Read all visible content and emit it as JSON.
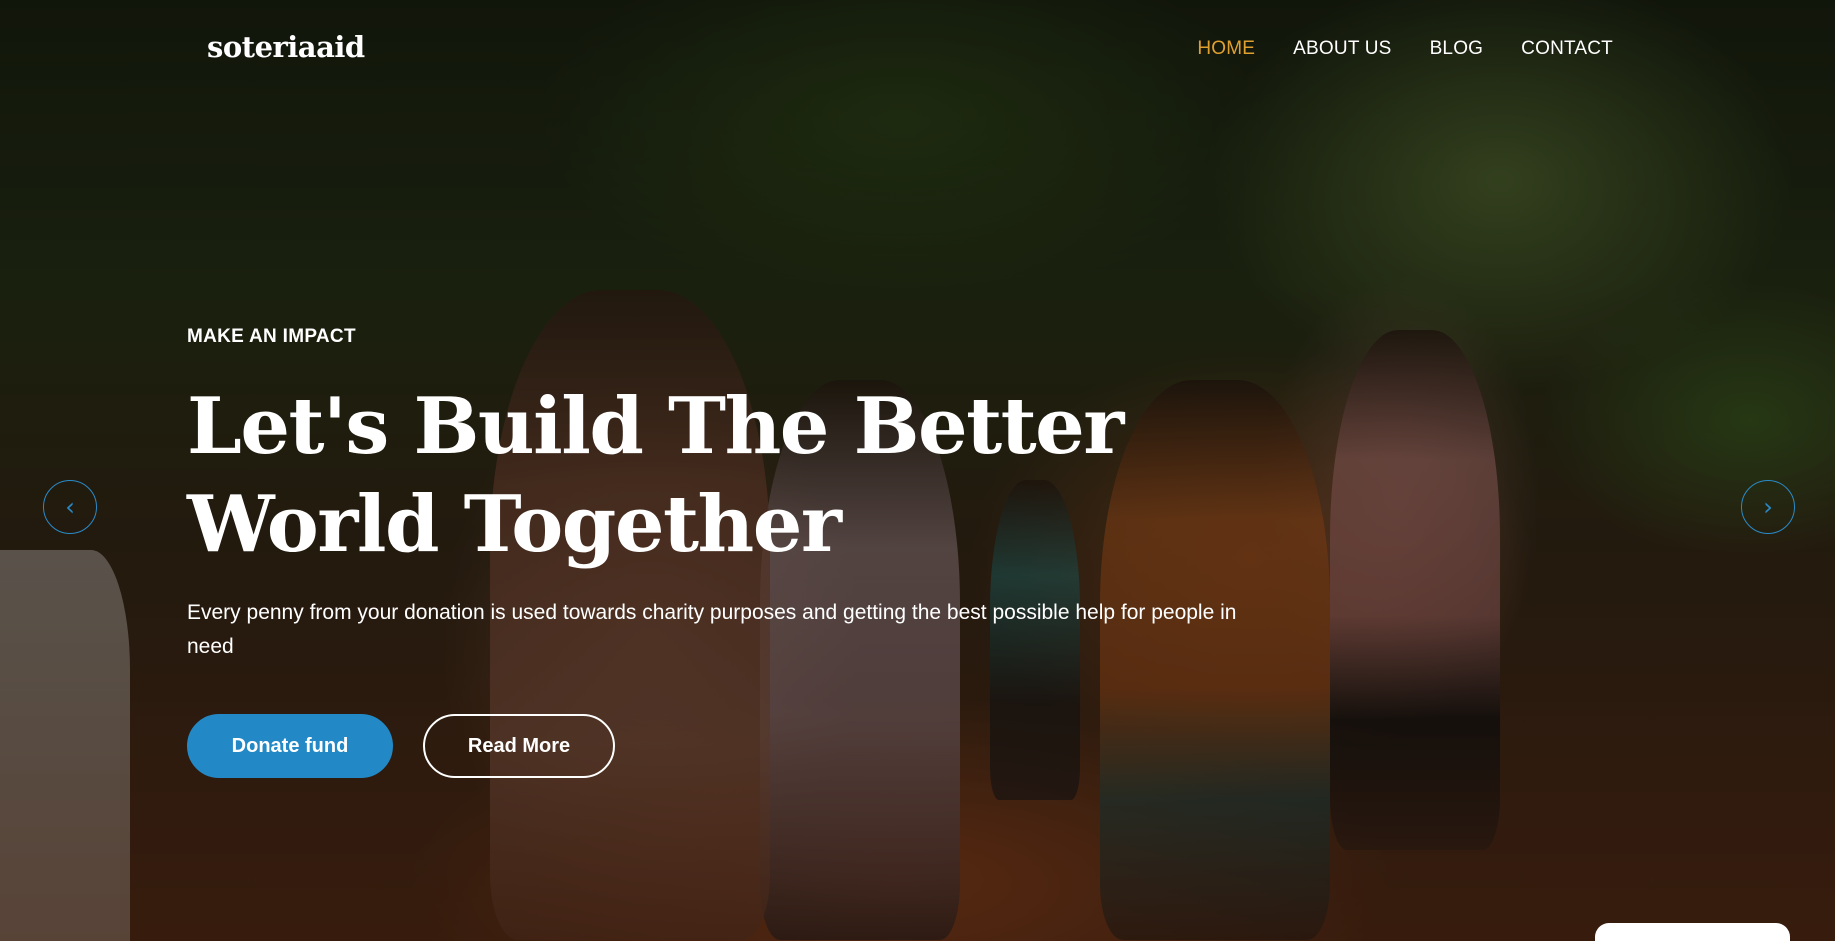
{
  "brand": {
    "logo": "soteriaaid"
  },
  "nav": {
    "items": [
      {
        "label": "HOME",
        "active": true
      },
      {
        "label": "ABOUT US",
        "active": false
      },
      {
        "label": "BLOG",
        "active": false
      },
      {
        "label": "CONTACT",
        "active": false
      }
    ]
  },
  "hero": {
    "eyebrow": "MAKE AN IMPACT",
    "headline_line1": "Let's Build The Better",
    "headline_line2": "World Together",
    "subtext": "Every penny from your donation is used towards charity purposes and getting the best possible help for people in need",
    "primary_button": "Donate fund",
    "secondary_button": "Read More"
  },
  "carousel": {
    "prev_icon": "‹",
    "next_icon": "›"
  },
  "colors": {
    "accent": "#2389c6",
    "active_nav": "#e0a030",
    "text": "#ffffff"
  }
}
